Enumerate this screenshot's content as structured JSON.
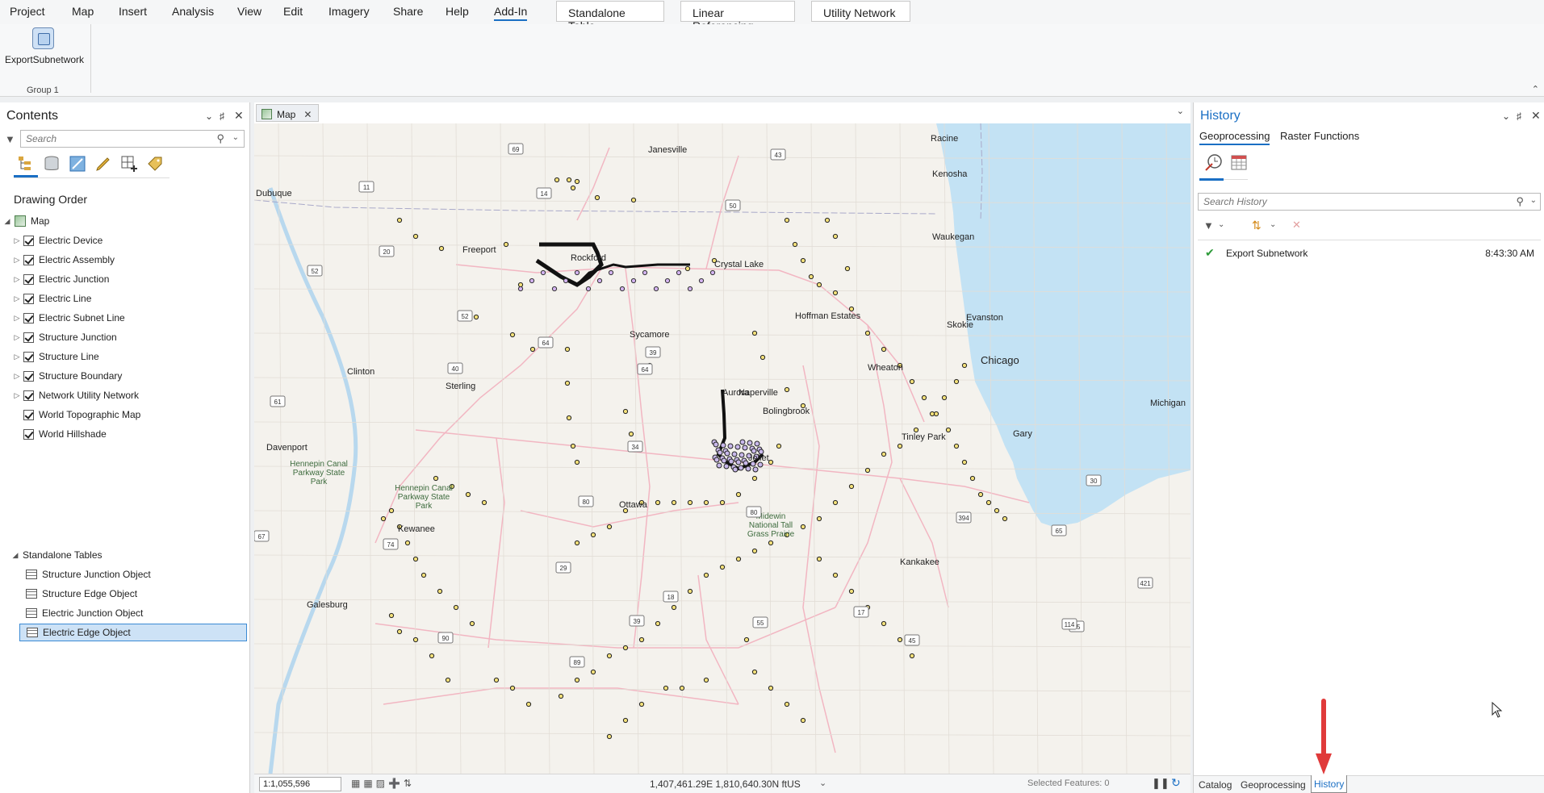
{
  "ribbon": {
    "tabs": [
      "Project",
      "Map",
      "Insert",
      "Analysis",
      "View",
      "Edit",
      "Imagery",
      "Share",
      "Help",
      "Add-In"
    ],
    "active_tab": "Add-In",
    "contextual_tabs": [
      "Standalone Table",
      "Linear Referencing",
      "Utility Network"
    ],
    "tool_label": "ExportSubnetwork",
    "group_label": "Group 1"
  },
  "contents": {
    "title": "Contents",
    "search_placeholder": "Search",
    "drawing_order": "Drawing Order",
    "map_label": "Map",
    "layers": [
      {
        "label": "Electric Device",
        "expandable": true
      },
      {
        "label": "Electric Assembly",
        "expandable": true
      },
      {
        "label": "Electric Junction",
        "expandable": true
      },
      {
        "label": "Electric Line",
        "expandable": true
      },
      {
        "label": "Electric Subnet Line",
        "expandable": true
      },
      {
        "label": "Structure Junction",
        "expandable": true
      },
      {
        "label": "Structure Line",
        "expandable": true
      },
      {
        "label": "Structure Boundary",
        "expandable": true
      },
      {
        "label": "Network Utility Network",
        "expandable": true
      },
      {
        "label": "World Topographic Map",
        "expandable": false
      },
      {
        "label": "World Hillshade",
        "expandable": false
      }
    ],
    "standalone_tables_label": "Standalone Tables",
    "tables": [
      "Structure Junction Object",
      "Structure Edge Object",
      "Electric Junction Object",
      "Electric Edge Object"
    ],
    "selected_table": "Electric Edge Object"
  },
  "map": {
    "tab_label": "Map",
    "cities": [
      {
        "name": "Janesville"
      },
      {
        "name": "Racine"
      },
      {
        "name": "Kenosha"
      },
      {
        "name": "Dubuque"
      },
      {
        "name": "Waukegan"
      },
      {
        "name": "Freeport"
      },
      {
        "name": "Rockford"
      },
      {
        "name": "Crystal Lake"
      },
      {
        "name": "Hoffman Estates"
      },
      {
        "name": "Evanston"
      },
      {
        "name": "Skokie"
      },
      {
        "name": "Sycamore"
      },
      {
        "name": "Chicago"
      },
      {
        "name": "Clinton"
      },
      {
        "name": "Wheaton"
      },
      {
        "name": "Sterling"
      },
      {
        "name": "Aurora"
      },
      {
        "name": "Naperville"
      },
      {
        "name": "Michigan"
      },
      {
        "name": "Bolingbrook"
      },
      {
        "name": "Davenport"
      },
      {
        "name": "Tinley Park"
      },
      {
        "name": "Gary"
      },
      {
        "name": "Joliet"
      },
      {
        "name": "Ottawa"
      },
      {
        "name": "Kewanee"
      },
      {
        "name": "Kankakee"
      },
      {
        "name": "Galesburg"
      }
    ],
    "parks": [
      "Hennepin Canal Parkway State Park",
      "Hennepin Canal Parkway State Park",
      "Midewin National Tall Grass Prairie"
    ],
    "shields": [
      "69",
      "43",
      "11",
      "14",
      "50",
      "20",
      "52",
      "52",
      "64",
      "39",
      "64",
      "40",
      "61",
      "34",
      "30",
      "80",
      "80",
      "394",
      "74",
      "67",
      "29",
      "18",
      "17",
      "65",
      "65",
      "421",
      "90",
      "39",
      "55",
      "45",
      "114",
      "89"
    ],
    "scale": "1:1,055,596",
    "coordinates": "1,407,461.29E 1,810,640.30N ftUS",
    "selected_features": "Selected Features: 0"
  },
  "history": {
    "title": "History",
    "tabs": [
      "Geoprocessing",
      "Raster Functions"
    ],
    "active_tab": "Geoprocessing",
    "search_placeholder": "Search History",
    "entries": [
      {
        "name": "Export Subnetwork",
        "time": "8:43:30 AM",
        "status": "success"
      }
    ],
    "bottom_tabs": [
      "Catalog",
      "Geoprocessing",
      "History"
    ],
    "active_bottom_tab": "History"
  },
  "colors": {
    "accent": "#1a6fc4",
    "lake": "#c3e2f4",
    "arrow": "#e03a3a"
  }
}
